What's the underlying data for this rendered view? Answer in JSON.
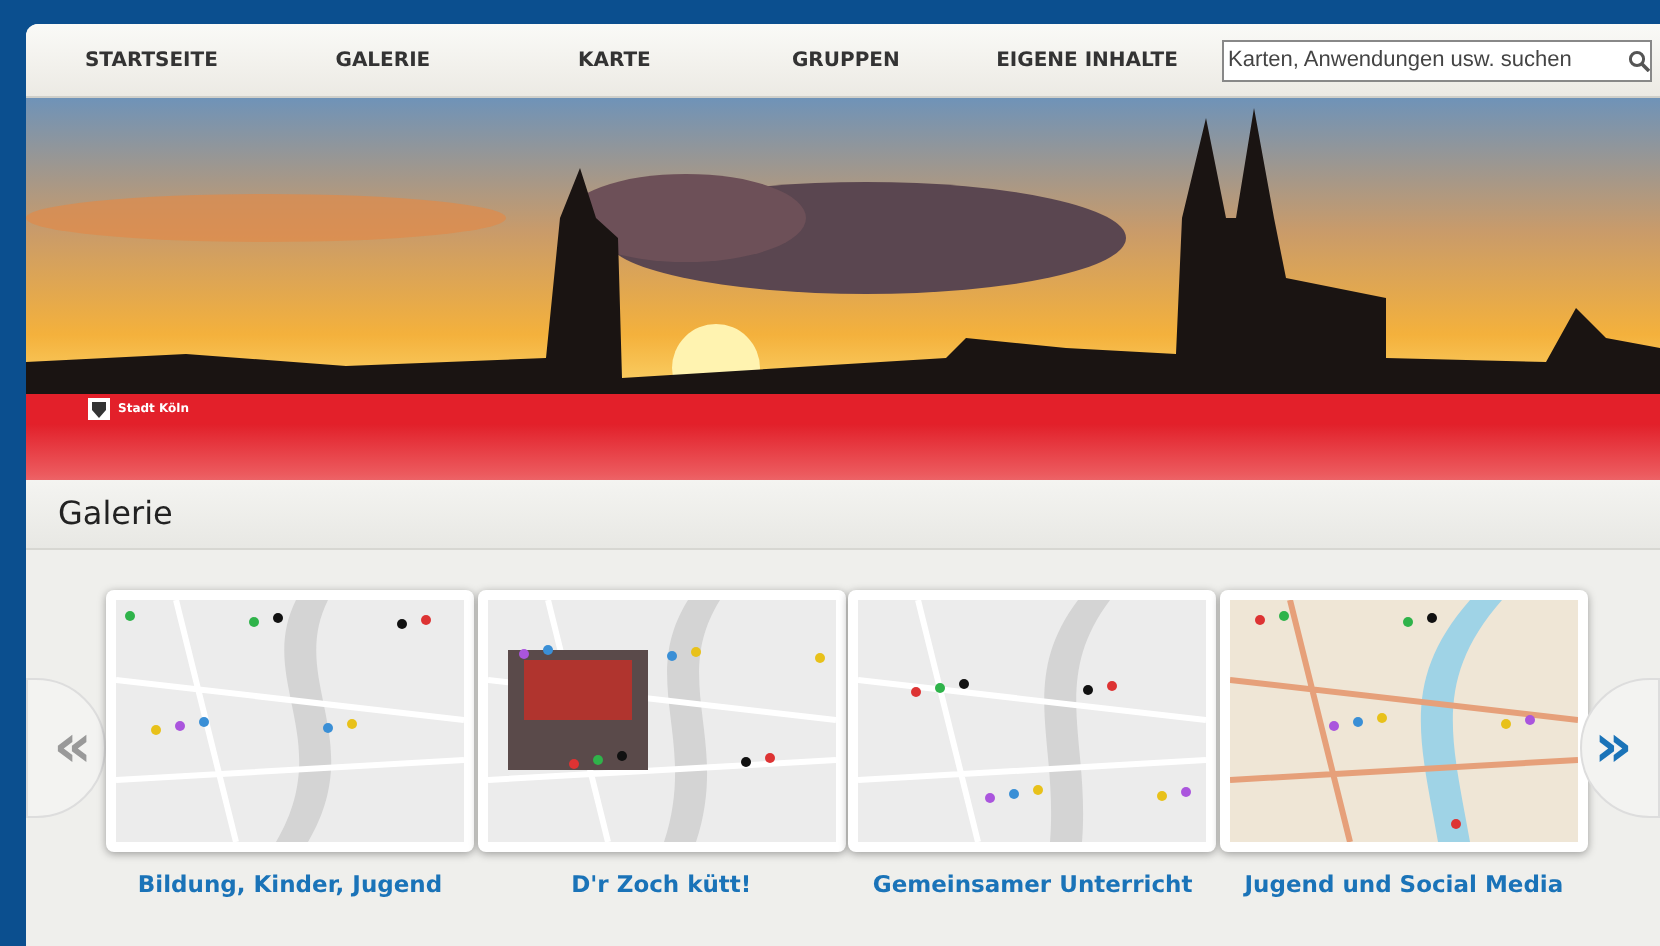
{
  "nav": [
    {
      "label": "STARTSEITE"
    },
    {
      "label": "GALERIE"
    },
    {
      "label": "KARTE"
    },
    {
      "label": "GRUPPEN"
    },
    {
      "label": "EIGENE INHALTE"
    }
  ],
  "search": {
    "placeholder": "Karten, Anwendungen usw. suchen"
  },
  "banner": {
    "logo_text": "Stadt Köln"
  },
  "gallery": {
    "title": "Galerie",
    "prev": "«",
    "next": "»",
    "items": [
      {
        "caption": "Bildung, Kinder, Jugend"
      },
      {
        "caption": "D'r Zoch kütt!"
      },
      {
        "caption": "Gemeinsamer Unterricht"
      },
      {
        "caption": "Jugend und Social Media"
      }
    ]
  }
}
